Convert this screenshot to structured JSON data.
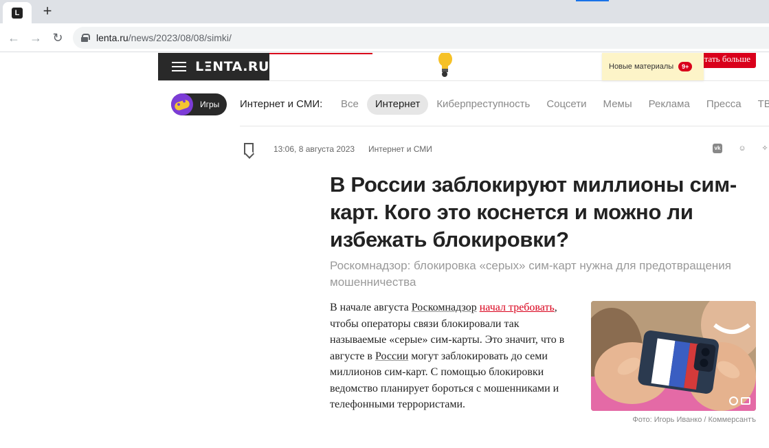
{
  "browser": {
    "favicon_letter": "L",
    "new_tab": "+",
    "url_domain": "lenta.ru",
    "url_path": "/news/2023/08/08/simki/"
  },
  "header": {
    "logo": "LΞNTA.RU",
    "more_button": "Читать больше",
    "new_materials": "Новые материалы",
    "new_materials_badge": "9+"
  },
  "categories": {
    "games_label": "Игры",
    "section_title": "Интернет и СМИ:",
    "items": [
      {
        "label": "Все",
        "active": false
      },
      {
        "label": "Интернет",
        "active": true
      },
      {
        "label": "Киберпреступность",
        "active": false
      },
      {
        "label": "Соцсети",
        "active": false
      },
      {
        "label": "Мемы",
        "active": false
      },
      {
        "label": "Реклама",
        "active": false
      },
      {
        "label": "Пресса",
        "active": false
      },
      {
        "label": "ТВ",
        "active": false
      }
    ]
  },
  "article": {
    "date": "13:06, 8 августа 2023",
    "rubric": "Интернет и СМИ",
    "share_vk": "vk",
    "share_ok": "ok",
    "headline": "В России заблокируют миллионы сим-карт. Кого это коснется и можно ли избежать блокировки?",
    "subtitle": "Роскомнадзор: блокировка «серых» сим-карт нужна для предотвращения мошенничества",
    "body": {
      "p1": "В начале августа ",
      "link1": "Роскомнадзор",
      "p2": " ",
      "link2": "начал требовать",
      "p3": ", чтобы операторы связи блокировали так называемые «серые» сим-карты. Это значит, что в августе в ",
      "link3": "России",
      "p4": " могут заблокировать до семи миллионов сим-карт. С помощью блокировки ведомство планирует бороться с мошенниками и телефонными террористами."
    },
    "photo_caption": "Фото: Игорь Иванко / Коммерсантъ"
  },
  "colors": {
    "brand_red": "#d9001b",
    "dark": "#292929",
    "active_pill": "#e6e6e6"
  }
}
